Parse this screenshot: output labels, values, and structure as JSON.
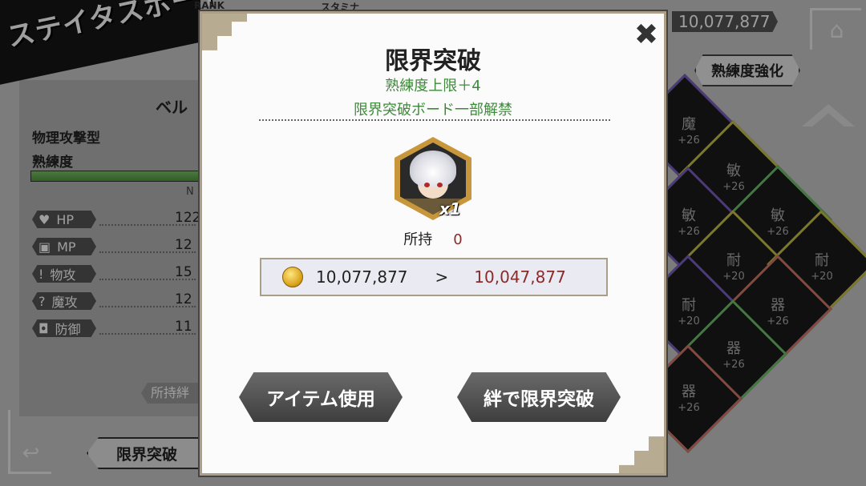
{
  "background": {
    "title": "ステイタスボード",
    "rank_label": "RANK",
    "stamina_label": "スタミナ",
    "currency_top": "10,077,877",
    "mastery_button": "熟練度強化",
    "character": {
      "name": "ベル",
      "type": "物理攻撃型",
      "mastery_label": "熟練度",
      "next_label": "N"
    },
    "stats": [
      {
        "icon": "heart-icon",
        "glyph": "♥",
        "label": "HP",
        "value": "122"
      },
      {
        "icon": "mp-icon",
        "glyph": "▣",
        "label": "MP",
        "value": "12"
      },
      {
        "icon": "sword-icon",
        "glyph": "!",
        "label": "物攻",
        "value": "15"
      },
      {
        "icon": "magic-icon",
        "glyph": "?",
        "label": "魔攻",
        "value": "12"
      },
      {
        "icon": "shield-icon",
        "glyph": "◘",
        "label": "防御",
        "value": "11"
      }
    ],
    "owned_bond_label": "所持絆",
    "limit_tab": "限界突破",
    "tiles": [
      {
        "name": "魔",
        "bonus": "+26"
      },
      {
        "name": "敏",
        "bonus": "+26"
      },
      {
        "name": "敏",
        "bonus": "+26"
      },
      {
        "name": "敏",
        "bonus": "+26"
      },
      {
        "name": "耐",
        "bonus": "+20"
      },
      {
        "name": "耐",
        "bonus": "+20"
      },
      {
        "name": "耐",
        "bonus": "+20"
      },
      {
        "name": "器",
        "bonus": "+26"
      },
      {
        "name": "器",
        "bonus": "+26"
      },
      {
        "name": "器",
        "bonus": "+26"
      }
    ]
  },
  "modal": {
    "title": "限界突破",
    "subtitle_1": "熟練度上限＋4",
    "subtitle_2": "限界突破ボード一部解禁",
    "item_quantity": "x1",
    "owned_label": "所持",
    "owned_value": "0",
    "cost_from": "10,077,877",
    "cost_arrow": ">",
    "cost_to": "10,047,877",
    "use_item_button": "アイテム使用",
    "bond_break_button": "絆で限界突破",
    "close_glyph": "✖"
  },
  "colors": {
    "accent_green": "#3e8a3a",
    "cost_red": "#8a2a2a",
    "frame_gold": "#ad9f86"
  }
}
